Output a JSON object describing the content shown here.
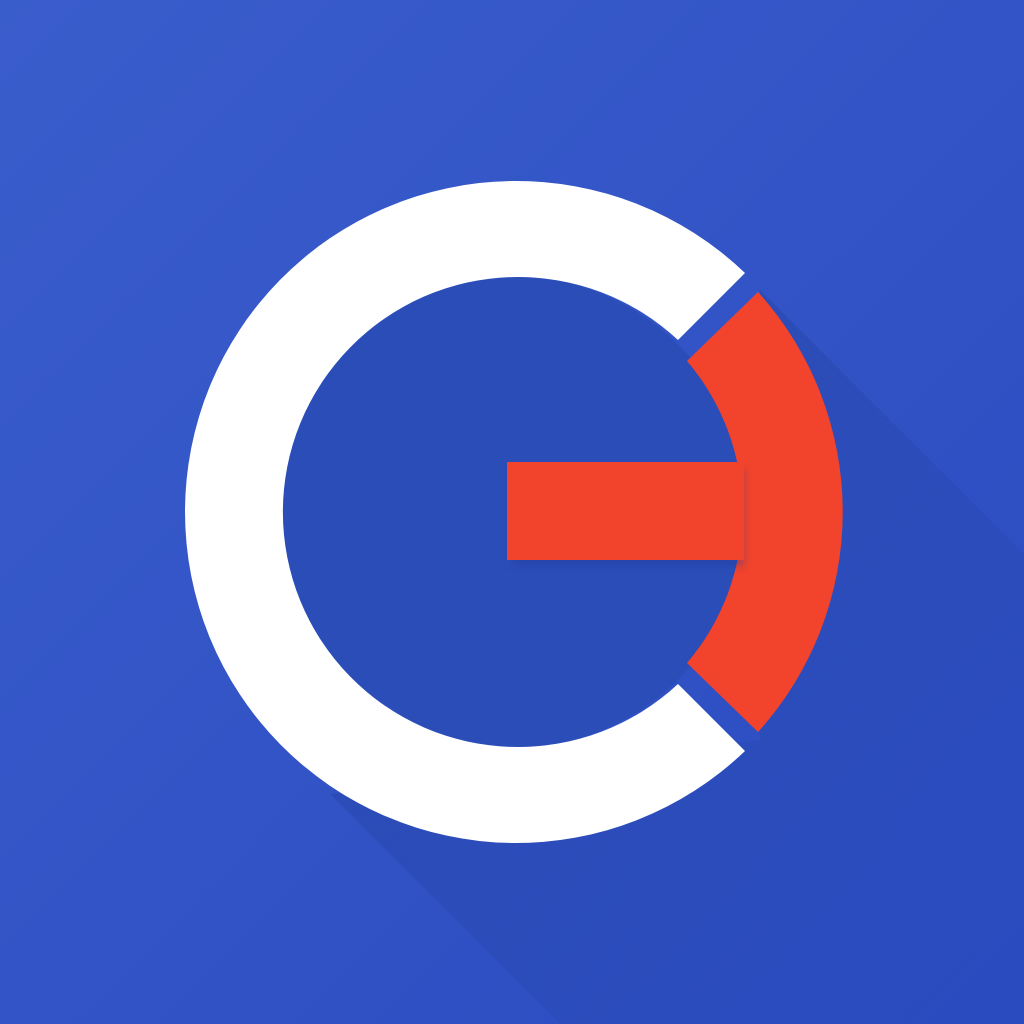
{
  "icon": {
    "name": "app-logo-icon",
    "colors": {
      "background_start": "#3a5dcc",
      "background_end": "#2a4bc0",
      "inner_disc": "#2b4db8",
      "ring": "#ffffff",
      "accent": "#f2432c",
      "long_shadow": "#213f9e"
    }
  }
}
